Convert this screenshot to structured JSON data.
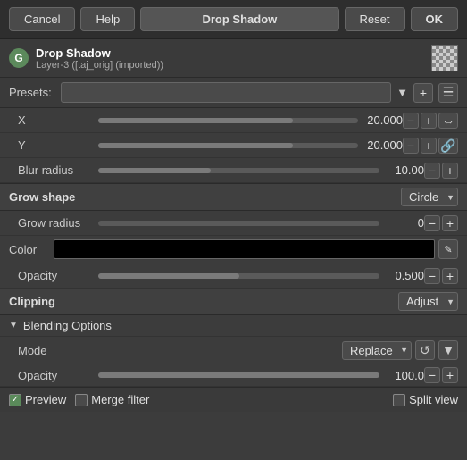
{
  "toolbar": {
    "cancel_label": "Cancel",
    "help_label": "Help",
    "title_label": "Drop Shadow",
    "reset_label": "Reset",
    "ok_label": "OK"
  },
  "header": {
    "icon_letter": "G",
    "title": "Drop Shadow",
    "subtitle": "Layer-3 ([taj_orig] (imported))"
  },
  "presets": {
    "label": "Presets:",
    "placeholder": "",
    "add_icon": "+",
    "menu_icon": "☰"
  },
  "params": {
    "x_label": "X",
    "x_value": "20.000",
    "x_fill_pct": 75,
    "y_label": "Y",
    "y_value": "20.000",
    "y_fill_pct": 75,
    "blur_label": "Blur radius",
    "blur_value": "10.00",
    "blur_fill_pct": 40
  },
  "grow": {
    "shape_label": "Grow shape",
    "shape_value": "Circle",
    "radius_label": "Grow radius",
    "radius_value": "0",
    "radius_fill_pct": 0
  },
  "color": {
    "label": "Color"
  },
  "opacity": {
    "label": "Opacity",
    "value": "0.500",
    "fill_pct": 50
  },
  "clipping": {
    "label": "Clipping",
    "value": "Adjust"
  },
  "blending": {
    "section_label": "Blending Options",
    "mode_label": "Mode",
    "mode_value": "Replace",
    "opacity_label": "Opacity",
    "opacity_value": "100.0",
    "opacity_fill_pct": 100
  },
  "bottom": {
    "preview_label": "Preview",
    "merge_label": "Merge filter",
    "split_label": "Split view"
  }
}
